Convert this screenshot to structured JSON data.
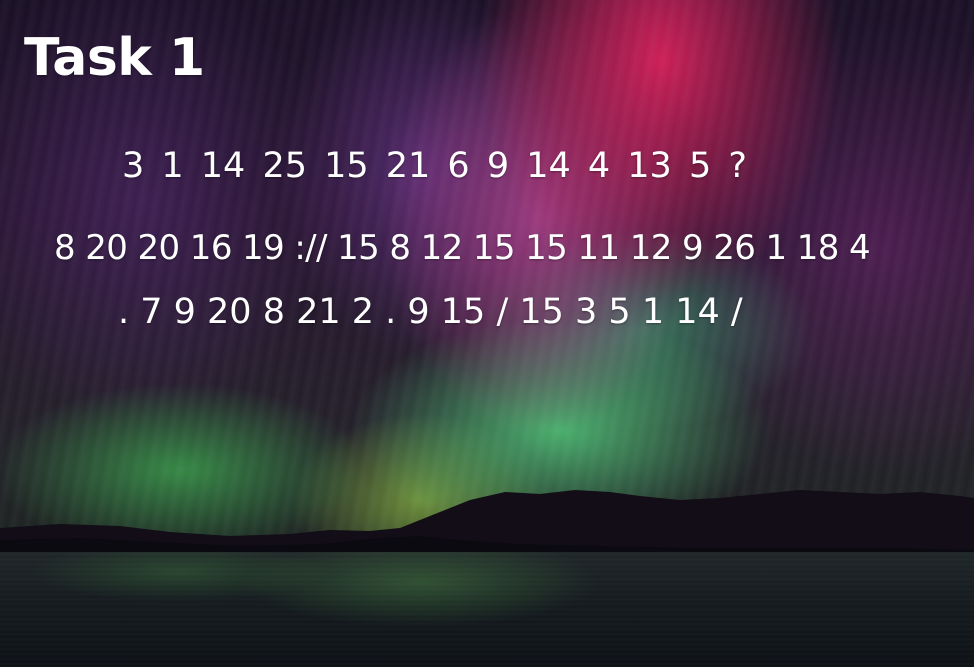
{
  "title": "Task 1",
  "cipher": {
    "line1": "3 1 14   25 15 21   6 9 14 4   13 5 ?",
    "line2": "8 20 20 16 19 :// 15 8 12 15 15 11 12 9 26 1 18 4",
    "line3": ". 7 9 20 8 21 2 . 9 15 / 15 3 5 1 14 /"
  },
  "colors": {
    "text": "#ffffff",
    "aurora_magenta": "#d6205a",
    "aurora_green": "#50c878",
    "night_sky": "#1a1026"
  },
  "background": "aurora-over-lake-photo"
}
